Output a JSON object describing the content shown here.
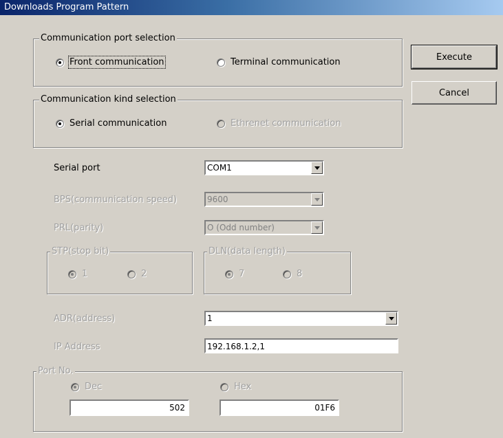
{
  "window": {
    "title": "Downloads Program Pattern"
  },
  "port_group": {
    "legend": "Communication port selection",
    "front": "Front communication",
    "terminal": "Terminal communication"
  },
  "kind_group": {
    "legend": "Communication kind selection",
    "serial": "Serial communication",
    "ethernet": "Ethrenet communication"
  },
  "buttons": {
    "execute": "Execute",
    "cancel": "Cancel"
  },
  "serial_port": {
    "label": "Serial port",
    "value": "COM1"
  },
  "bps": {
    "label": "BPS(communication speed)",
    "value": "9600"
  },
  "prl": {
    "label": "PRL(parity)",
    "value": "O (Odd number)"
  },
  "stp": {
    "legend": "STP(stop bit)",
    "opt1": "1",
    "opt2": "2"
  },
  "dln": {
    "legend": "DLN(data length)",
    "opt1": "7",
    "opt2": "8"
  },
  "adr": {
    "label": "ADR(address)",
    "value": "1"
  },
  "ip": {
    "label": "IP Address",
    "value": "192.168.1.2,1"
  },
  "port_no": {
    "legend": "Port No.",
    "dec": "Dec",
    "hex": "Hex",
    "dec_value": "502",
    "hex_value": "01F6"
  }
}
